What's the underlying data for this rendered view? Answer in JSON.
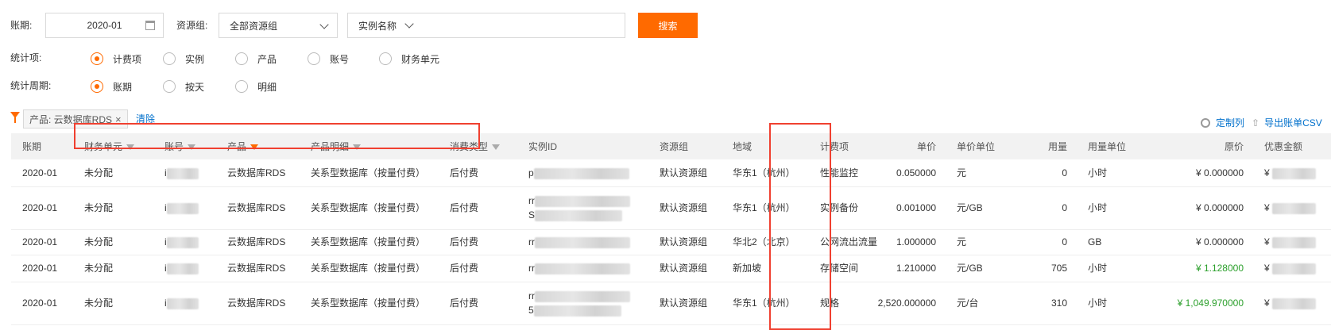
{
  "filters": {
    "period_label": "账期:",
    "period_value": "2020-01",
    "resource_group_label": "资源组:",
    "resource_group_value": "全部资源组",
    "instance_placeholder": "实例名称",
    "search_button": "搜索"
  },
  "stat_item": {
    "label": "统计项:",
    "options": [
      "计费项",
      "实例",
      "产品",
      "账号",
      "财务单元"
    ],
    "selected": "计费项"
  },
  "stat_period": {
    "label": "统计周期:",
    "options": [
      "账期",
      "按天",
      "明细"
    ],
    "selected": "账期"
  },
  "active_filter": {
    "tag": "产品: 云数据库RDS",
    "clear": "清除"
  },
  "toolbar": {
    "customize_columns": "定制列",
    "export_csv": "导出账单CSV"
  },
  "table": {
    "headers": [
      "账期",
      "财务单元",
      "账号",
      "产品",
      "产品明细",
      "消费类型",
      "实例ID",
      "资源组",
      "地域",
      "计费项",
      "单价",
      "单价单位",
      "用量",
      "用量单位",
      "原价",
      "优惠金额"
    ],
    "rows": [
      {
        "period": "2020-01",
        "unit": "未分配",
        "account": "i",
        "product": "云数据库RDS",
        "detail": "关系型数据库（按量付费）",
        "type": "后付费",
        "instance": "p",
        "instance2": "",
        "group": "默认资源组",
        "region": "华东1（杭州）",
        "item": "性能监控",
        "price": "0.050000",
        "price_unit": "元",
        "usage": "0",
        "usage_unit": "小时",
        "original": "¥ 0.000000",
        "original_green": false,
        "discount": "¥"
      },
      {
        "period": "2020-01",
        "unit": "未分配",
        "account": "i",
        "product": "云数据库RDS",
        "detail": "关系型数据库（按量付费）",
        "type": "后付费",
        "instance": "rr",
        "instance2": "S",
        "group": "默认资源组",
        "region": "华东1（杭州）",
        "item": "实例备份",
        "price": "0.001000",
        "price_unit": "元/GB",
        "usage": "0",
        "usage_unit": "小时",
        "original": "¥ 0.000000",
        "original_green": false,
        "discount": "¥"
      },
      {
        "period": "2020-01",
        "unit": "未分配",
        "account": "i",
        "product": "云数据库RDS",
        "detail": "关系型数据库（按量付费）",
        "type": "后付费",
        "instance": "rr",
        "instance2": "",
        "group": "默认资源组",
        "region": "华北2（北京）",
        "item": "公网流出流量",
        "price": "1.000000",
        "price_unit": "元",
        "usage": "0",
        "usage_unit": "GB",
        "original": "¥ 0.000000",
        "original_green": false,
        "discount": "¥"
      },
      {
        "period": "2020-01",
        "unit": "未分配",
        "account": "i",
        "product": "云数据库RDS",
        "detail": "关系型数据库（按量付费）",
        "type": "后付费",
        "instance": "rr",
        "instance2": "",
        "group": "默认资源组",
        "region": "新加坡",
        "item": "存储空间",
        "price": "1.210000",
        "price_unit": "元/GB",
        "usage": "705",
        "usage_unit": "小时",
        "original": "¥ 1.128000",
        "original_green": true,
        "discount": "¥"
      },
      {
        "period": "2020-01",
        "unit": "未分配",
        "account": "i",
        "product": "云数据库RDS",
        "detail": "关系型数据库（按量付费）",
        "type": "后付费",
        "instance": "rr",
        "instance2": "5",
        "group": "默认资源组",
        "region": "华东1（杭州）",
        "item": "规格",
        "price": "2,520.000000",
        "price_unit": "元/台",
        "usage": "310",
        "usage_unit": "小时",
        "original": "¥ 1,049.970000",
        "original_green": true,
        "discount": "¥"
      }
    ]
  },
  "colors": {
    "accent": "#ff6a00",
    "link": "#0070cc",
    "highlight": "#f04030",
    "positive": "#2ca02c"
  }
}
